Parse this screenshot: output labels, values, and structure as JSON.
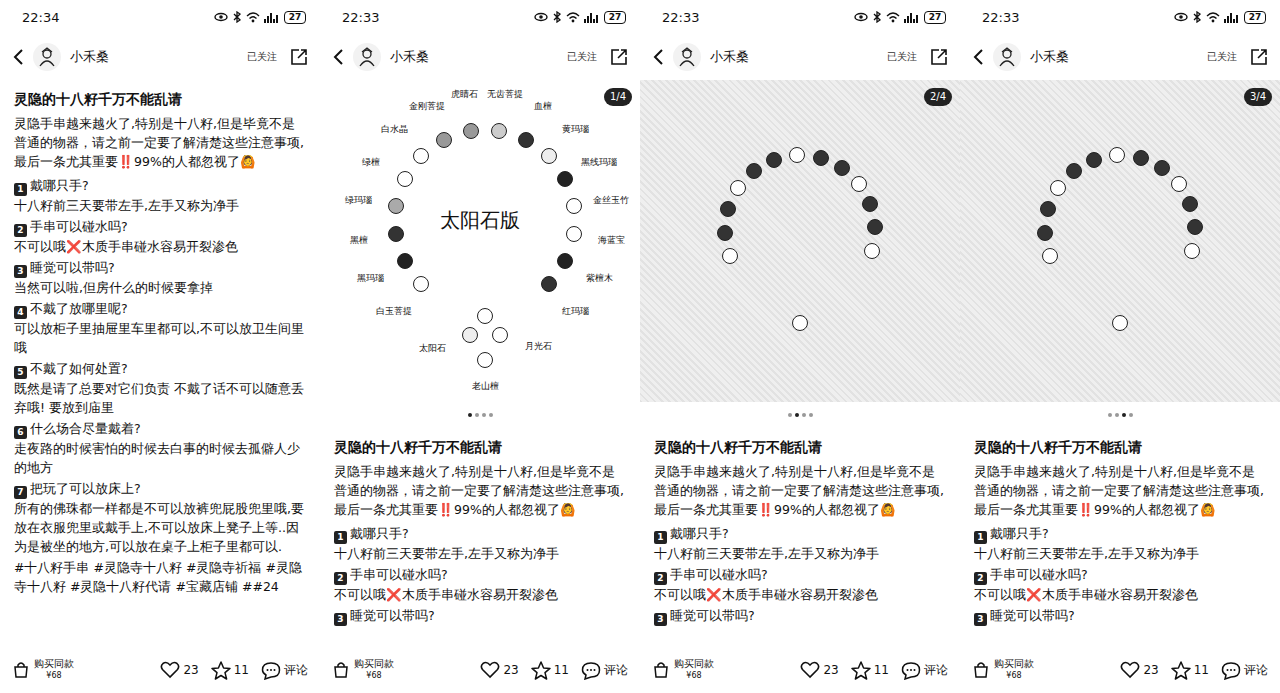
{
  "panels": [
    {
      "kind": "text",
      "status": {
        "time": "22:34",
        "battery": "27"
      },
      "header": {
        "author": "小禾桑",
        "follow": "已关注"
      },
      "post": {
        "title": "灵隐的十八籽千万不能乱请",
        "intro": "灵隐手串越来越火了,特别是十八籽,但是毕竟不是普通的物器，请之前一定要了解清楚这些注意事项,最后一条尤其重要‼️99%的人都忽视了🙆",
        "items": [
          {
            "num": "1",
            "question": "戴哪只手?",
            "answer": "十八籽前三天要带左手,左手又称为净手"
          },
          {
            "num": "2",
            "question": "手串可以碰水吗?",
            "answer": "不可以哦❌木质手串碰水容易开裂渗色"
          },
          {
            "num": "3",
            "question": "睡觉可以带吗?",
            "answer": "当然可以啦,但房什么的时候要拿掉"
          },
          {
            "num": "4",
            "question": "不戴了放哪里呢?",
            "answer": "可以放柜子里抽屉里车里都可以,不可以放卫生间里哦"
          },
          {
            "num": "5",
            "question": "不戴了如何处置?",
            "answer": "既然是请了总要对它们负责 不戴了话不可以随意丢弃哦! 要放到庙里"
          },
          {
            "num": "6",
            "question": "什么场合尽量戴着?",
            "answer": "走夜路的时候害怕的时候去白事的时候去孤僻人少的地方"
          },
          {
            "num": "7",
            "question": "把玩了可以放床上?",
            "answer": "所有的佛珠都一样都是不可以放裤兜屁股兜里哦,要放在衣服兜里或戴手上,不可以放床上凳子上等..因为是被坐的地方,可以放在桌子上柜子里都可以."
          }
        ],
        "tags": [
          "#十八籽手串",
          "#灵隐寺十八籽",
          "#灵隐寺祈福",
          "#灵隐寺十八籽",
          "#灵隐十八籽代请",
          "#宝藏店铺",
          "##24"
        ]
      },
      "bottom": {
        "buy": "购买同款",
        "price": "¥68",
        "likes": "23",
        "stars": "11",
        "comment": "评论"
      }
    },
    {
      "kind": "gallery",
      "status": {
        "time": "22:33",
        "battery": "27"
      },
      "header": {
        "author": "小禾桑",
        "follow": "已关注"
      },
      "gallery": {
        "page": "1/4",
        "image": {
          "kind": "diagram",
          "center": "太阳石版",
          "labels": [
            {
              "text": "白玉菩提",
              "color": "#ffffff"
            },
            {
              "text": "黑玛瑙",
              "color": "#222222"
            },
            {
              "text": "黑檀",
              "color": "#333333"
            },
            {
              "text": "绿玛瑙",
              "color": "#aaaaaa"
            },
            {
              "text": "绿檀",
              "color": "#ffffff"
            },
            {
              "text": "白水晶",
              "color": "#ffffff"
            },
            {
              "text": "金刚菩提",
              "color": "#999999"
            },
            {
              "text": "虎睛石",
              "color": "#999999"
            },
            {
              "text": "无齿菩提",
              "color": "#cccccc"
            },
            {
              "text": "血檀",
              "color": "#333333"
            },
            {
              "text": "黄玛瑙",
              "color": "#eeeeee"
            },
            {
              "text": "黑线玛瑙",
              "color": "#222222"
            },
            {
              "text": "金丝玉竹",
              "color": "#ffffff"
            },
            {
              "text": "海蓝宝",
              "color": "#ffffff"
            },
            {
              "text": "紫檀木",
              "color": "#222222"
            },
            {
              "text": "红玛瑙",
              "color": "#333333"
            }
          ],
          "pendant": [
            {
              "text": "太阳石",
              "color": "#eeeeee"
            },
            {
              "text": "月光石",
              "color": "#ffffff"
            },
            {
              "text": "老山檀",
              "color": "#ffffff"
            }
          ]
        },
        "dots": [
          {
            "selected": true
          },
          {
            "selected": false
          },
          {
            "selected": false
          },
          {
            "selected": false
          }
        ]
      },
      "post": {
        "title": "灵隐的十八籽千万不能乱请",
        "intro": "灵隐手串越来越火了,特别是十八籽,但是毕竟不是普通的物器，请之前一定要了解清楚这些注意事项,最后一条尤其重要‼️99%的人都忽视了🙆",
        "items": [
          {
            "num": "1",
            "question": "戴哪只手?",
            "answer": "十八籽前三天要带左手,左手又称为净手"
          },
          {
            "num": "2",
            "question": "手串可以碰水吗?",
            "answer": "不可以哦❌木质手串碰水容易开裂渗色"
          },
          {
            "num": "3",
            "question": "睡觉可以带吗?"
          }
        ],
        "tags": []
      },
      "bottom": {
        "buy": "购买同款",
        "price": "¥68",
        "likes": "23",
        "stars": "11",
        "comment": "评论"
      }
    },
    {
      "kind": "gallery",
      "status": {
        "time": "22:33",
        "battery": "27"
      },
      "header": {
        "author": "小禾桑",
        "follow": "已关注"
      },
      "gallery": {
        "page": "2/4",
        "image": {
          "kind": "photo"
        },
        "dots": [
          {
            "selected": false
          },
          {
            "selected": true
          },
          {
            "selected": false
          },
          {
            "selected": false
          }
        ]
      },
      "post": {
        "title": "灵隐的十八籽千万不能乱请",
        "intro": "灵隐手串越来越火了,特别是十八籽,但是毕竟不是普通的物器，请之前一定要了解清楚这些注意事项,最后一条尤其重要‼️99%的人都忽视了🙆",
        "items": [
          {
            "num": "1",
            "question": "戴哪只手?",
            "answer": "十八籽前三天要带左手,左手又称为净手"
          },
          {
            "num": "2",
            "question": "手串可以碰水吗?",
            "answer": "不可以哦❌木质手串碰水容易开裂渗色"
          },
          {
            "num": "3",
            "question": "睡觉可以带吗?"
          }
        ],
        "tags": []
      },
      "bottom": {
        "buy": "购买同款",
        "price": "¥68",
        "likes": "23",
        "stars": "11",
        "comment": "评论"
      }
    },
    {
      "kind": "gallery",
      "status": {
        "time": "22:33",
        "battery": "27"
      },
      "header": {
        "author": "小禾桑",
        "follow": "已关注"
      },
      "gallery": {
        "page": "3/4",
        "image": {
          "kind": "photo"
        },
        "dots": [
          {
            "selected": false
          },
          {
            "selected": false
          },
          {
            "selected": true
          },
          {
            "selected": false
          }
        ]
      },
      "post": {
        "title": "灵隐的十八籽千万不能乱请",
        "intro": "灵隐手串越来越火了,特别是十八籽,但是毕竟不是普通的物器，请之前一定要了解清楚这些注意事项,最后一条尤其重要‼️99%的人都忽视了🙆",
        "items": [
          {
            "num": "1",
            "question": "戴哪只手?",
            "answer": "十八籽前三天要带左手,左手又称为净手"
          },
          {
            "num": "2",
            "question": "手串可以碰水吗?",
            "answer": "不可以哦❌木质手串碰水容易开裂渗色"
          },
          {
            "num": "3",
            "question": "睡觉可以带吗?"
          }
        ],
        "tags": []
      },
      "bottom": {
        "buy": "购买同款",
        "price": "¥68",
        "likes": "23",
        "stars": "11",
        "comment": "评论"
      }
    }
  ]
}
